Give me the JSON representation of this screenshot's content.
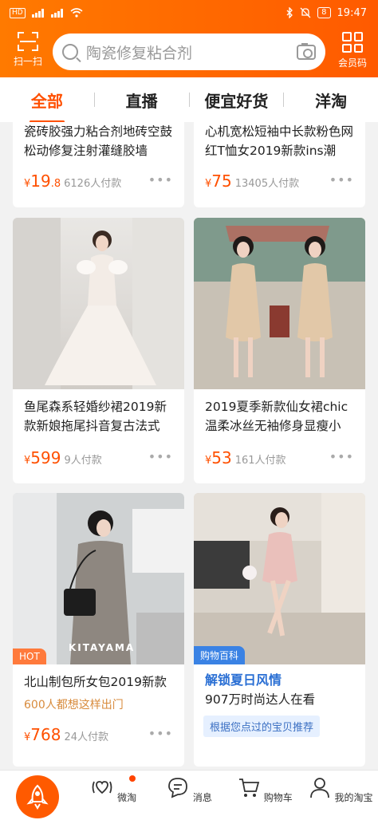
{
  "status_bar": {
    "hd_label": "HD",
    "time": "19:47",
    "battery": "8"
  },
  "header": {
    "scan_label": "扫一扫",
    "search_placeholder": "陶瓷修复粘合剂",
    "vip_label": "会员码"
  },
  "tabs": [
    {
      "label": "全部",
      "active": true
    },
    {
      "label": "直播",
      "active": false
    },
    {
      "label": "便宜好货",
      "active": false
    },
    {
      "label": "洋淘",
      "active": false
    }
  ],
  "products": [
    {
      "title": "瓷砖胶强力粘合剂地砖空鼓松动修复注射灌缝胶墙",
      "price_main": "19",
      "price_dec": ".8",
      "sold": "6126人付款"
    },
    {
      "title": "心机宽松短袖中长款粉色网红T恤女2019新款ins潮",
      "price_main": "75",
      "price_dec": "",
      "sold": "13405人付款"
    },
    {
      "title": "鱼尾森系轻婚纱裙2019新款新娘拖尾抖音复古法式",
      "price_main": "599",
      "price_dec": "",
      "sold": "9人付款"
    },
    {
      "title": "2019夏季新款仙女裙chic温柔冰丝无袖修身显瘦小",
      "price_main": "53",
      "price_dec": "",
      "sold": "161人付款"
    },
    {
      "badge": "HOT",
      "brand": "KITAYAMA",
      "title": "北山制包所女包2019新款",
      "subtitle": "600人都想这样出门",
      "price_main": "768",
      "price_dec": "",
      "sold": "24人付款"
    },
    {
      "badge": "购物百科",
      "title": "解锁夏日风情",
      "subtitle": "907万时尚达人在看",
      "tag": "根据您点过的宝贝推荐"
    }
  ],
  "currency": "¥",
  "more_dots": "•••",
  "bottom_nav": [
    {
      "label": "",
      "icon": "rocket-icon"
    },
    {
      "label": "微淘",
      "icon": "weitao-icon"
    },
    {
      "label": "消息",
      "icon": "message-icon"
    },
    {
      "label": "购物车",
      "icon": "cart-icon"
    },
    {
      "label": "我的淘宝",
      "icon": "user-icon"
    }
  ],
  "colors": {
    "brand_orange": "#ff5000",
    "header_gradient_start": "#ff7a00",
    "wiki_blue": "#2a6fd4"
  }
}
